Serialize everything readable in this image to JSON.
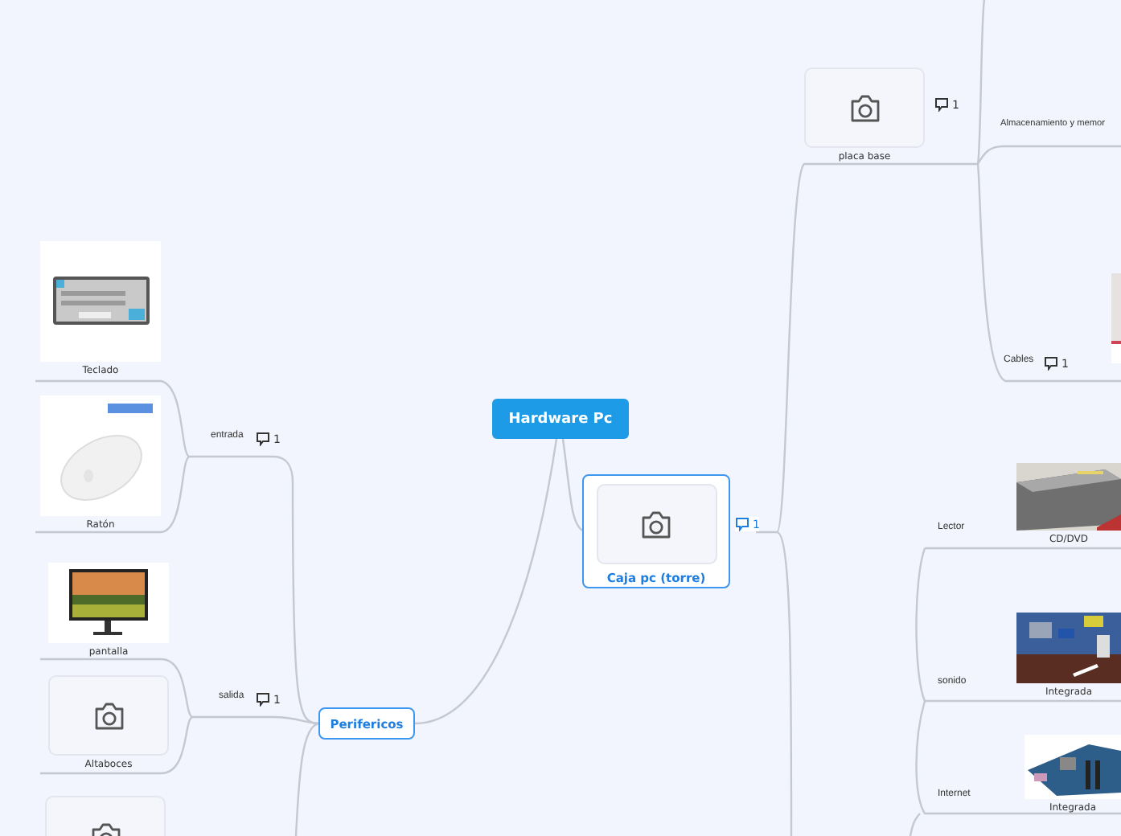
{
  "nodes": [
    {
      "kind": "root",
      "label": "Hardware Pc"
    },
    {
      "kind": "main",
      "label": "Caja pc (torre)",
      "comments": "1"
    },
    {
      "kind": "main",
      "label": "Perifericos"
    },
    {
      "kind": "placeholder",
      "label": "placa base",
      "comments": "1"
    },
    {
      "kind": "text",
      "label": "Almacenamiento y memor"
    },
    {
      "kind": "text",
      "label": "Cables",
      "comments": "1"
    },
    {
      "kind": "picture"
    },
    {
      "kind": "text",
      "label": "Lector"
    },
    {
      "kind": "picture",
      "label": "CD/DVD"
    },
    {
      "kind": "text",
      "label": "sonido"
    },
    {
      "kind": "picture",
      "label": "Integrada"
    },
    {
      "kind": "text",
      "label": "Internet"
    },
    {
      "kind": "picture",
      "label": "Integrada"
    },
    {
      "kind": "text",
      "label": "entrada",
      "comments": "1"
    },
    {
      "kind": "picture",
      "label": "Teclado"
    },
    {
      "kind": "picture",
      "label": "Ratón"
    },
    {
      "kind": "text",
      "label": "salida",
      "comments": "1"
    },
    {
      "kind": "picture",
      "label": "pantalla"
    },
    {
      "kind": "placeholder",
      "label": "Altaboces"
    },
    {
      "kind": "placeholder"
    }
  ]
}
